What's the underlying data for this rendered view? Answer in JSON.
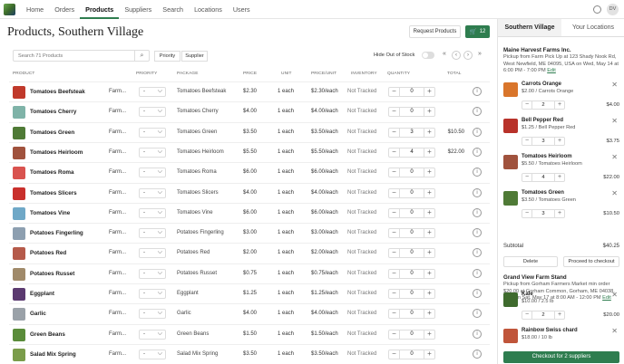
{
  "app": {
    "logo_label": "Logo"
  },
  "nav": [
    {
      "label": "Home",
      "active": false
    },
    {
      "label": "Orders",
      "active": false
    },
    {
      "label": "Products",
      "active": true
    },
    {
      "label": "Suppliers",
      "active": false
    },
    {
      "label": "Search",
      "active": false
    },
    {
      "label": "Locations",
      "active": false
    },
    {
      "label": "Users",
      "active": false
    }
  ],
  "user": {
    "initials": "DV"
  },
  "page": {
    "title": "Products, Southern Village"
  },
  "toolbar": {
    "request_label": "Request Products",
    "cart_count": "12",
    "search_placeholder": "Search 71 Products",
    "filter_priority": "Priority",
    "filter_supplier": "Supplier",
    "hide_oos_label": "Hide Out of Stock",
    "pager_first": "«",
    "pager_prev": "‹",
    "pager_next": "›",
    "pager_last": "»"
  },
  "columns": {
    "product": "PRODUCT",
    "priority": "PRIORITY",
    "package": "PACKAGE",
    "price": "PRICE",
    "unit": "UNIT",
    "price_unit": "PRICE/UNIT",
    "inventory": "INVENTORY",
    "quantity": "QUANTITY",
    "total": "TOTAL"
  },
  "rows": [
    {
      "name": "Tomatoes Beefsteak",
      "supplier": "Farm...",
      "priority": "-",
      "package": "Tomatoes Beefsteak",
      "price": "$2.30",
      "unit": "1 each",
      "ppu": "$2.30/each",
      "inventory": "Not Tracked",
      "qty": "0",
      "total": "",
      "color": "#c0392b"
    },
    {
      "name": "Tomatoes Cherry",
      "supplier": "Farm...",
      "priority": "-",
      "package": "Tomatoes Cherry",
      "price": "$4.00",
      "unit": "1 each",
      "ppu": "$4.00/each",
      "inventory": "Not Tracked",
      "qty": "0",
      "total": "",
      "color": "#7fb3a8"
    },
    {
      "name": "Tomatoes Green",
      "supplier": "Farm...",
      "priority": "-",
      "package": "Tomatoes Green",
      "price": "$3.50",
      "unit": "1 each",
      "ppu": "$3.50/each",
      "inventory": "Not Tracked",
      "qty": "3",
      "total": "$10.50",
      "color": "#4f7a36"
    },
    {
      "name": "Tomatoes Heirloom",
      "supplier": "Farm...",
      "priority": "-",
      "package": "Tomatoes Heirloom",
      "price": "$5.50",
      "unit": "1 each",
      "ppu": "$5.50/each",
      "inventory": "Not Tracked",
      "qty": "4",
      "total": "$22.00",
      "color": "#a0523d"
    },
    {
      "name": "Tomatoes Roma",
      "supplier": "Farm...",
      "priority": "-",
      "package": "Tomatoes Roma",
      "price": "$6.00",
      "unit": "1 each",
      "ppu": "$6.00/each",
      "inventory": "Not Tracked",
      "qty": "0",
      "total": "",
      "color": "#d9534f"
    },
    {
      "name": "Tomatoes Slicers",
      "supplier": "Farm...",
      "priority": "-",
      "package": "Tomatoes Slicers",
      "price": "$4.00",
      "unit": "1 each",
      "ppu": "$4.00/each",
      "inventory": "Not Tracked",
      "qty": "0",
      "total": "",
      "color": "#c9302c"
    },
    {
      "name": "Tomatoes Vine",
      "supplier": "Farm...",
      "priority": "-",
      "package": "Tomatoes Vine",
      "price": "$6.00",
      "unit": "1 each",
      "ppu": "$6.00/each",
      "inventory": "Not Tracked",
      "qty": "0",
      "total": "",
      "color": "#6fa8c7"
    },
    {
      "name": "Potatoes Fingerling",
      "supplier": "Farm...",
      "priority": "-",
      "package": "Potatoes Fingerling",
      "price": "$3.00",
      "unit": "1 each",
      "ppu": "$3.00/each",
      "inventory": "Not Tracked",
      "qty": "0",
      "total": "",
      "color": "#8d9fb0"
    },
    {
      "name": "Potatoes Red",
      "supplier": "Farm...",
      "priority": "-",
      "package": "Potatoes Red",
      "price": "$2.00",
      "unit": "1 each",
      "ppu": "$2.00/each",
      "inventory": "Not Tracked",
      "qty": "0",
      "total": "",
      "color": "#b55a4a"
    },
    {
      "name": "Potatoes Russet",
      "supplier": "Farm...",
      "priority": "-",
      "package": "Potatoes Russet",
      "price": "$0.75",
      "unit": "1 each",
      "ppu": "$0.75/each",
      "inventory": "Not Tracked",
      "qty": "0",
      "total": "",
      "color": "#a08a6a"
    },
    {
      "name": "Eggplant",
      "supplier": "Farm...",
      "priority": "-",
      "package": "Eggplant",
      "price": "$1.25",
      "unit": "1 each",
      "ppu": "$1.25/each",
      "inventory": "Not Tracked",
      "qty": "0",
      "total": "",
      "color": "#5b3a70"
    },
    {
      "name": "Garlic",
      "supplier": "Farm...",
      "priority": "-",
      "package": "Garlic",
      "price": "$4.00",
      "unit": "1 each",
      "ppu": "$4.00/each",
      "inventory": "Not Tracked",
      "qty": "0",
      "total": "",
      "color": "#9aa1a8"
    },
    {
      "name": "Green Beans",
      "supplier": "Farm...",
      "priority": "-",
      "package": "Green Beans",
      "price": "$1.50",
      "unit": "1 each",
      "ppu": "$1.50/each",
      "inventory": "Not Tracked",
      "qty": "0",
      "total": "",
      "color": "#5a8c3a"
    },
    {
      "name": "Salad Mix Spring",
      "supplier": "Farm...",
      "priority": "-",
      "package": "Salad Mix Spring",
      "price": "$3.50",
      "unit": "1 each",
      "ppu": "$3.50/each",
      "inventory": "Not Tracked",
      "qty": "0",
      "total": "",
      "color": "#7a9c4a"
    }
  ],
  "sidebar": {
    "tab_active": "Southern Village",
    "tab_other": "Your Locations",
    "supplier1": {
      "name": "Maine Harvest Farms Inc.",
      "info": "Pickup from Farm Pick Up at 123 Shady Nook Rd, West Newfield, ME 04095, USA on Wed, May 14 at 6:00 PM - 7:00 PM",
      "edit": "Edit",
      "items": [
        {
          "name": "Carrots Orange",
          "price": "$2.00 / Carrots Orange",
          "qty": "2",
          "total": "$4.00",
          "color": "#d9752b"
        },
        {
          "name": "Bell Pepper Red",
          "price": "$1.25 / Bell Pepper Red",
          "qty": "3",
          "total": "$3.75",
          "color": "#b8322a"
        },
        {
          "name": "Tomatoes Heirloom",
          "price": "$5.50 / Tomatoes Heirloom",
          "qty": "4",
          "total": "$22.00",
          "color": "#a0523d"
        },
        {
          "name": "Tomatoes Green",
          "price": "$3.50 / Tomatoes Green",
          "qty": "3",
          "total": "$10.50",
          "color": "#4f7a36"
        }
      ],
      "subtotal_label": "Subtotal",
      "subtotal": "$40.25",
      "delete_label": "Delete",
      "proceed_label": "Proceed to checkout"
    },
    "supplier2": {
      "name": "Grand View Farm Stand",
      "info": "Pickup from Gorham Farmers Market min order $20.00 at Gorham Common, Gorham, ME 04038, USA on Sat, May 17 at 8:00 AM - 12:00 PM",
      "edit": "Edit",
      "items": [
        {
          "name": "Kale",
          "price": "$10.00 / 2.5 lb",
          "qty": "2",
          "total": "$20.00",
          "color": "#3f6b2e"
        },
        {
          "name": "Rainbow Swiss chard",
          "price": "$18.00 / 10 lb",
          "qty": "",
          "total": "",
          "color": "#c0553a"
        }
      ]
    },
    "checkout_label": "Checkout for 2 suppliers"
  },
  "colors": {
    "accent": "#2e7d4f"
  },
  "icons": {
    "search": "search-icon",
    "cart": "cart-icon",
    "gear": "gear-icon",
    "info": "info-icon",
    "close": "close-icon"
  }
}
